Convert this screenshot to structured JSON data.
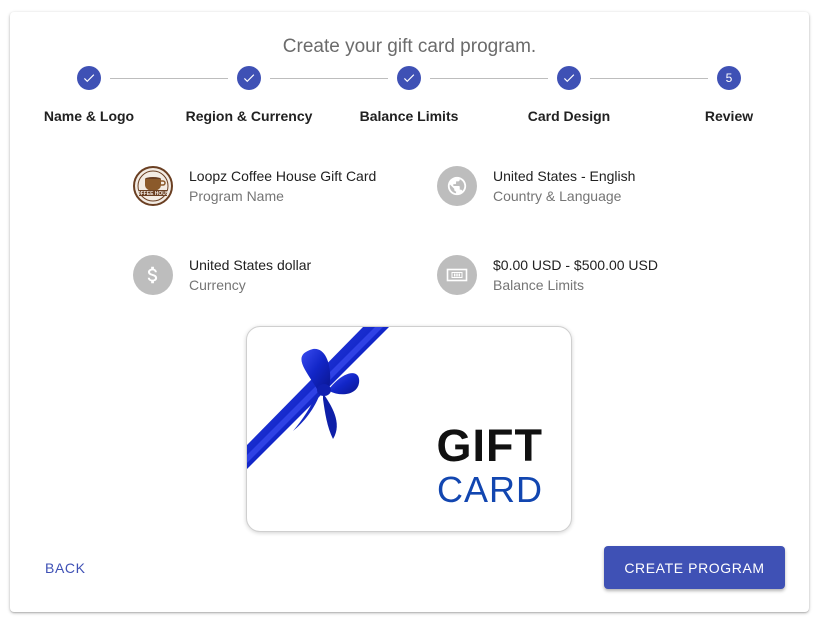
{
  "title": "Create your gift card program.",
  "stepper": {
    "steps": [
      {
        "label": "Name & Logo",
        "state": "completed",
        "icon": "check-icon"
      },
      {
        "label": "Region & Currency",
        "state": "completed",
        "icon": "check-icon"
      },
      {
        "label": "Balance Limits",
        "state": "completed",
        "icon": "check-icon"
      },
      {
        "label": "Card Design",
        "state": "completed",
        "icon": "check-icon"
      },
      {
        "label": "Review",
        "state": "active",
        "number": "5"
      }
    ]
  },
  "summary": {
    "program_name": {
      "value": "Loopz Coffee House Gift Card",
      "label": "Program Name",
      "icon": "coffee-logo-icon",
      "logo_text": "OFFEE HOUS"
    },
    "country": {
      "value": "United States - English",
      "label": "Country & Language",
      "icon": "globe-icon"
    },
    "currency": {
      "value": "United States dollar",
      "label": "Currency",
      "icon": "dollar-icon"
    },
    "balance": {
      "value": "$0.00 USD - $500.00 USD",
      "label": "Balance Limits",
      "icon": "money-bill-icon"
    }
  },
  "card_preview": {
    "line1": "GIFT",
    "line2": "CARD",
    "ribbon_color": "#1a2fd8"
  },
  "buttons": {
    "back": "BACK",
    "create": "CREATE PROGRAM"
  },
  "colors": {
    "primary": "#3f51b5",
    "icon_bg": "#bdbdbd"
  }
}
